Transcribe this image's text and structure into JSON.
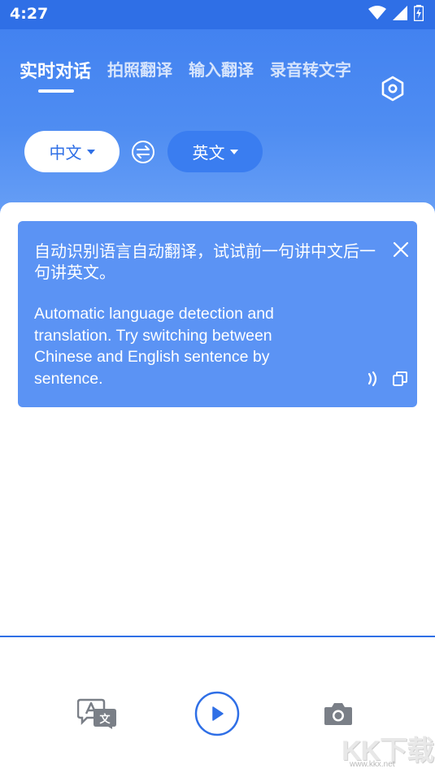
{
  "status": {
    "time": "4:27",
    "icons": [
      "wifi-icon",
      "signal-icon",
      "battery-charging-icon"
    ]
  },
  "tabs": [
    {
      "label": "实时对话",
      "active": true
    },
    {
      "label": "拍照翻译",
      "active": false
    },
    {
      "label": "输入翻译",
      "active": false
    },
    {
      "label": "录音转文字",
      "active": false
    }
  ],
  "languages": {
    "source": "中文",
    "target": "英文"
  },
  "card": {
    "text_zh": "自动识别语言自动翻译，试试前一句讲中文后一句讲英文。",
    "text_en": "Automatic language detection and translation. Try switching between Chinese and English sentence by sentence."
  },
  "watermark": {
    "text": "KK下载",
    "url": "www.kkx.net"
  },
  "colors": {
    "primary": "#2f6fe6",
    "card": "#5b93f4",
    "header_gradient_top": "#3f7ff0",
    "header_gradient_bottom": "#6da3f6"
  }
}
